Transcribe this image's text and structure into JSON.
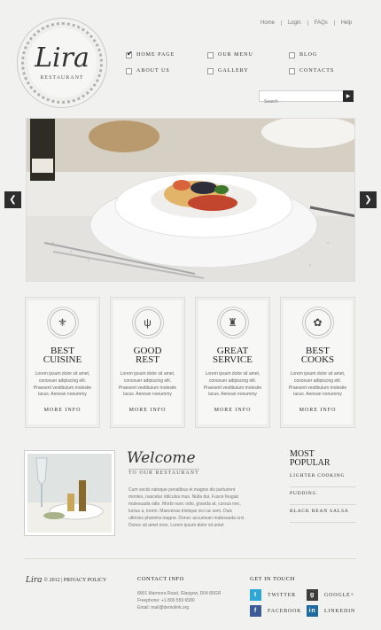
{
  "top_links": [
    "Home",
    "Login",
    "FAQs",
    "Help"
  ],
  "logo": {
    "script": "Lira",
    "sub": "RESTAURANT"
  },
  "nav": {
    "row1": [
      "HOME PAGE",
      "OUR MENU",
      "BLOG"
    ],
    "row2": [
      "ABOUT US",
      "GALLERY",
      "CONTACTS"
    ]
  },
  "search": {
    "placeholder": "Search",
    "button": "▶"
  },
  "slider": {
    "prev": "❮",
    "next": "❯"
  },
  "features": [
    {
      "title1": "BEST",
      "title2": "CUISINE",
      "icon": "⚜",
      "text": "Lorem ipsum dolor sit amet, conceuer adipiscing elit. Praesent vestibulum molestie lacus. Aenean nonummy",
      "more": "MORE INFO"
    },
    {
      "title1": "GOOD",
      "title2": "REST",
      "icon": "ψ",
      "text": "Lorem ipsum dolor sit amet, conceuer adipiscing elit. Praesent vestibulum molestie lacus. Aenean nonummy",
      "more": "MORE INFO"
    },
    {
      "title1": "GREAT",
      "title2": "SERVICE",
      "icon": "♜",
      "text": "Lorem ipsum dolor sit amet, conceuer adipiscing elit. Praesent vestibulum molestie lacus. Aenean nonummy",
      "more": "MORE INFO"
    },
    {
      "title1": "BEST",
      "title2": "COOKS",
      "icon": "✿",
      "text": "Lorem ipsum dolor sit amet, conceuer adipiscing elit. Praesent vestibulum molestie lacus. Aenean nonummy",
      "more": "MORE INFO"
    }
  ],
  "welcome": {
    "title": "Welcome",
    "sub": "TO OUR RESTAURANT",
    "text": "Cum sociis natoque penatibus et magnis dis parturient montes, nascetur ridiculus mus. Nulla dui. Fusce feugiat malesuada odio. Morbi nunc odio, gravida at, cursus nec, luctus a, lorem. Maecenas tristique orci ac sem. Duis ultricies pharetra magna. Donec accumsan malesuada orci. Donec sit amet eros. Lorem ipsum dolor sit amet"
  },
  "popular": {
    "title1": "MOST",
    "title2": "POPULAR",
    "items": [
      "LIGHTER COOKING",
      "PUDDING",
      "BLACK BEAN SALSA"
    ]
  },
  "footer": {
    "logo": "Lira",
    "copyright": "© 2012 | PRIVACY POLICY",
    "contact_title": "CONTACT INFO",
    "contact_lines": [
      "8901 Marmora Road, Glasgow, D04 89GR",
      "Freephone:      +1 800 559 6580",
      "Email: mail@demolink.org"
    ],
    "touch_title": "GET IN TOUCH",
    "social": [
      {
        "label": "TWITTER",
        "icon": "t",
        "color": "#2ea7d6"
      },
      {
        "label": "GOOGLE+",
        "icon": "g",
        "color": "#3d3d3d"
      },
      {
        "label": "FACEBOOK",
        "icon": "f",
        "color": "#3b5b98"
      },
      {
        "label": "LINKEDIN",
        "icon": "in",
        "color": "#1f6aa0"
      }
    ]
  }
}
